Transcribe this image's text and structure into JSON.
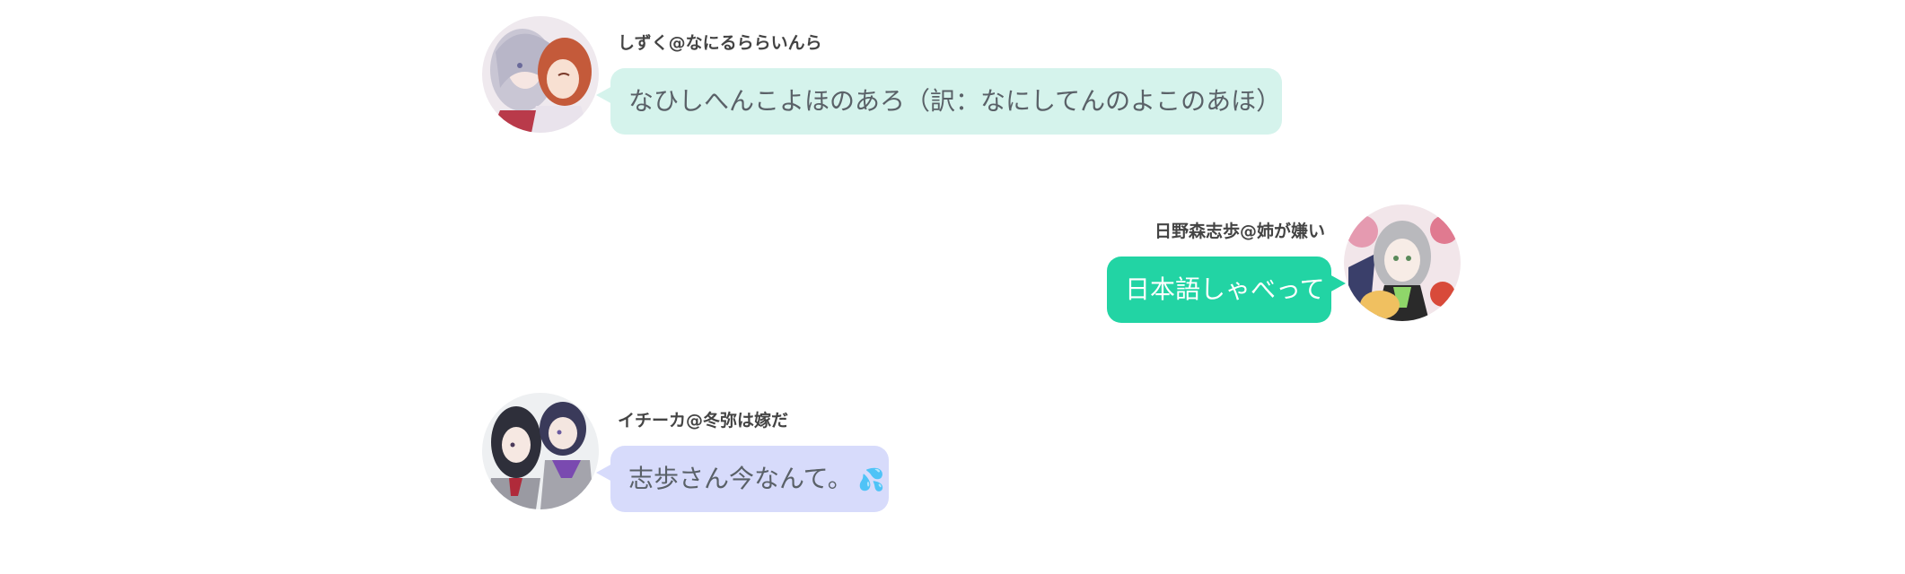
{
  "messages": [
    {
      "side": "left",
      "sender": "しずく@なにるららいんら",
      "text": "なひしへんこよほのあろ（訳：なにしてんのよこのあほ）",
      "bubble_color": "#d5f3ec",
      "avatar_icon": "avatar-girls-whisper"
    },
    {
      "side": "right",
      "sender": "日野森志歩@姉が嫌い",
      "text": "日本語しゃべって",
      "bubble_color": "#22d4a4",
      "avatar_icon": "avatar-silver-hair-girl"
    },
    {
      "side": "left",
      "sender": "イチーカ@冬弥は嫁だ",
      "text": "志歩さん今なんて。",
      "emoji": "💦",
      "bubble_color": "#d7dbfb",
      "avatar_icon": "avatar-pair-students"
    }
  ]
}
